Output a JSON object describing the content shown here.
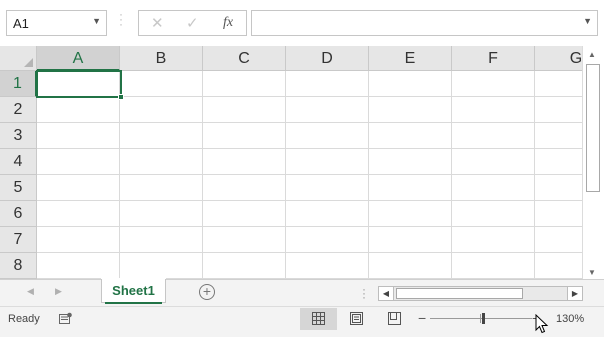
{
  "formula_bar": {
    "name_box_value": "A1",
    "name_box_dropdown_icon": "chevron-down-icon",
    "cancel_icon": "✕",
    "enter_icon": "✓",
    "function_label": "fx",
    "formula_value": "",
    "expand_icon": "chevron-down-icon"
  },
  "columns": [
    "A",
    "B",
    "C",
    "D",
    "E",
    "F",
    "G"
  ],
  "rows": [
    "1",
    "2",
    "3",
    "4",
    "5",
    "6",
    "7",
    "8"
  ],
  "selected_cell": "A1",
  "sheets": [
    "Sheet1"
  ],
  "active_sheet": "Sheet1",
  "add_sheet_icon": "⊕",
  "status": {
    "text": "Ready",
    "zoom_level": "130%",
    "zoom_minus": "−",
    "zoom_plus": "+"
  },
  "colors": {
    "accent": "#217346",
    "header_bg": "#e6e6e6",
    "gridline": "#dadada"
  }
}
